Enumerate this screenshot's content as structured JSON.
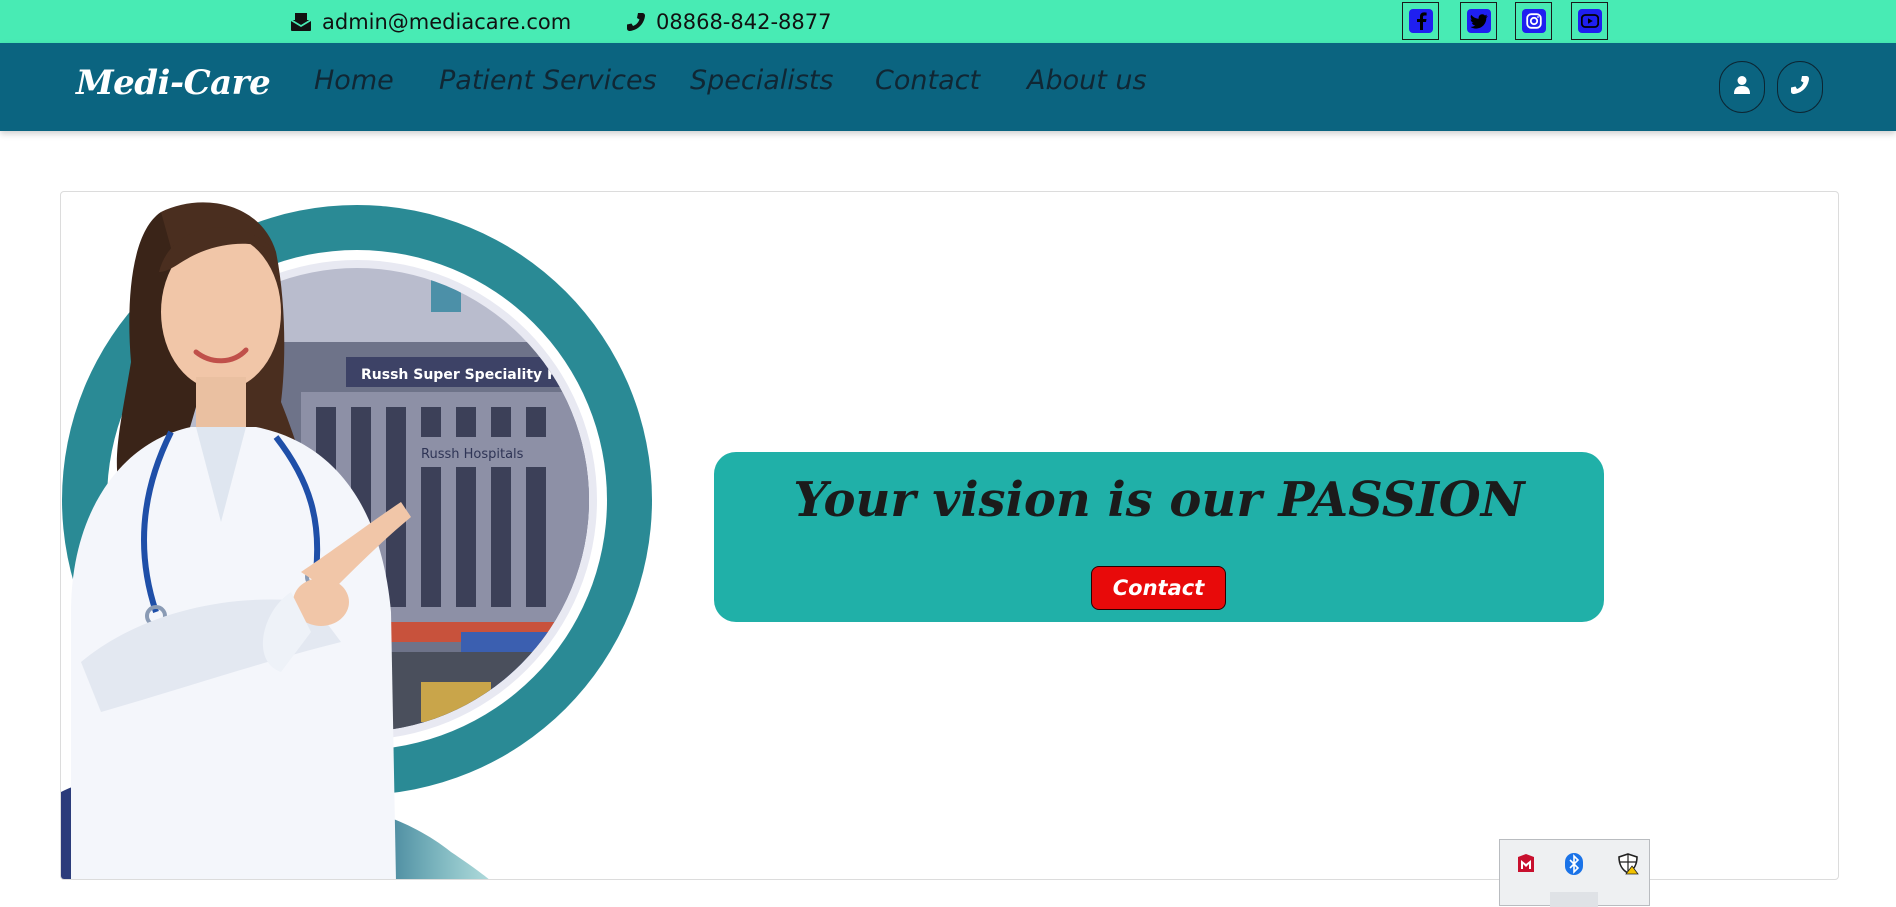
{
  "topbar": {
    "email": "admin@mediacare.com",
    "phone": "08868-842-8877",
    "email_icon": "mail-icon",
    "phone_icon": "phone-icon",
    "socials": [
      {
        "name": "facebook-icon"
      },
      {
        "name": "twitter-icon"
      },
      {
        "name": "instagram-icon"
      },
      {
        "name": "youtube-icon"
      }
    ],
    "colors": {
      "background": "#48ebb4",
      "social": "#1f1ff0"
    }
  },
  "navbar": {
    "brand": "Medi-Care",
    "links": [
      "Home",
      "Patient Services",
      "Specialists",
      "Contact",
      "About us"
    ],
    "buttons": [
      {
        "icon": "user-icon"
      },
      {
        "icon": "phone-icon"
      }
    ],
    "colors": {
      "background": "#0b6480",
      "brand": "#ffffff"
    }
  },
  "hero": {
    "building_sign": "Russh Super Speciality Hos",
    "building_sign_2": "Russh Hospitals",
    "headline": "Your vision is our PASSION",
    "button_label": "Contact",
    "colors": {
      "card": "#20b0a8",
      "button": "#e80a0a",
      "ring": "#2a8a95"
    }
  },
  "tray": {
    "icons": [
      "mcafee-icon",
      "bluetooth-icon",
      "security-warning-icon"
    ]
  }
}
